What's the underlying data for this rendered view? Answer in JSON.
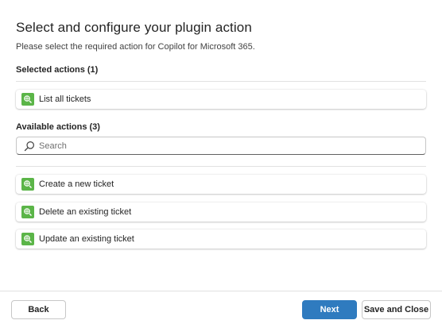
{
  "header": {
    "title": "Select and configure your plugin action",
    "subtitle": "Please select the required action for Copilot for Microsoft 365."
  },
  "selected": {
    "label": "Selected actions (1)",
    "items": [
      {
        "label": "List all tickets",
        "icon": "plugin-action-icon"
      }
    ]
  },
  "available": {
    "label": "Available actions (3)",
    "search_placeholder": "Search",
    "search_value": "",
    "items": [
      {
        "label": "Create a new ticket",
        "icon": "plugin-action-icon"
      },
      {
        "label": "Delete an existing ticket",
        "icon": "plugin-action-icon"
      },
      {
        "label": "Update an existing ticket",
        "icon": "plugin-action-icon"
      }
    ]
  },
  "footer": {
    "back_label": "Back",
    "next_label": "Next",
    "save_close_label": "Save and Close"
  },
  "colors": {
    "primary": "#2f7bbf",
    "action_icon": "#5bb548"
  }
}
